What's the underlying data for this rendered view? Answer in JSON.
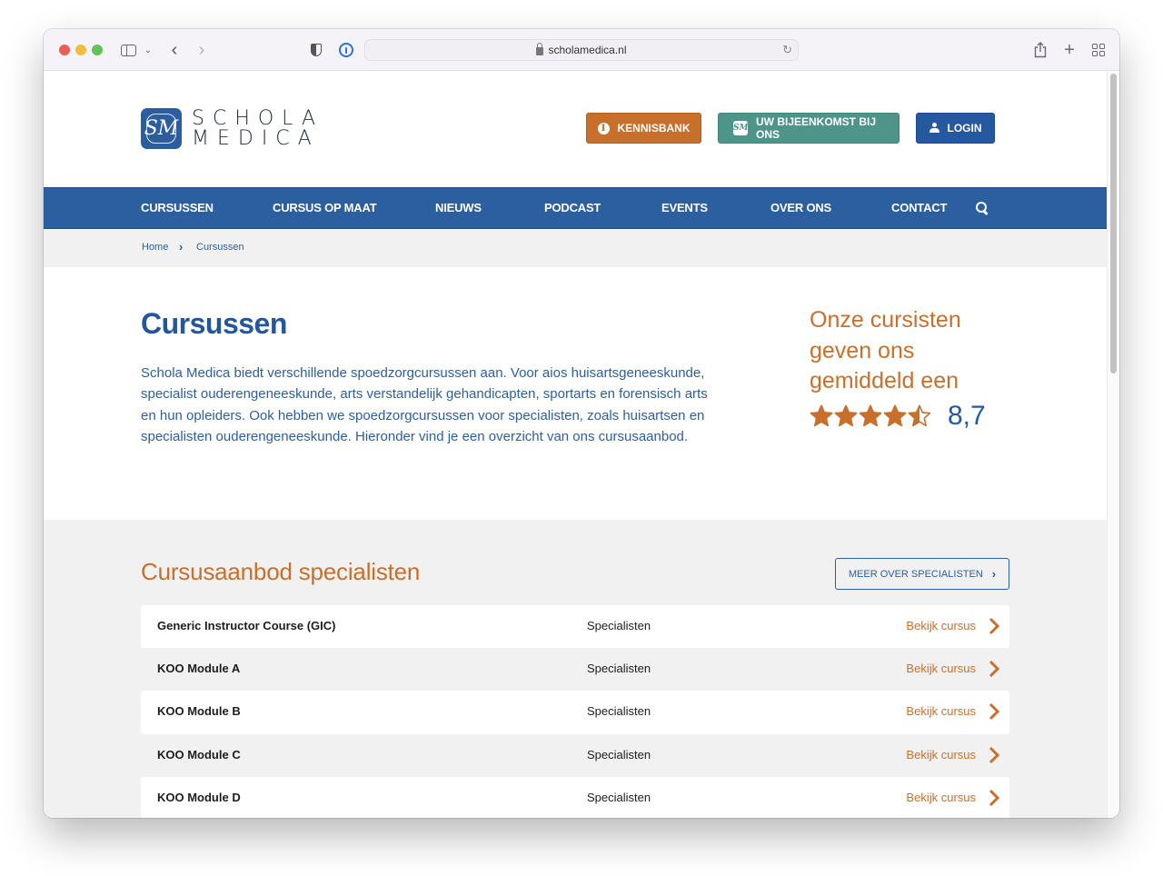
{
  "browser": {
    "url": "scholamedica.nl"
  },
  "header": {
    "logo_line1": "SCHOLA",
    "logo_line2": "MEDICA",
    "logo_mark": "SM",
    "buttons": {
      "kennisbank": "KENNISBANK",
      "bijeenkomst": "UW BIJEENKOMST BIJ ONS",
      "login": "LOGIN"
    },
    "colors": {
      "kennisbank": "#c8702b",
      "bijeenkomst": "#4f9489",
      "login": "#2658a0"
    }
  },
  "nav": {
    "items": [
      {
        "label": "CURSUSSEN"
      },
      {
        "label": "CURSUS OP MAAT"
      },
      {
        "label": "NIEUWS"
      },
      {
        "label": "PODCAST"
      },
      {
        "label": "EVENTS"
      },
      {
        "label": "OVER ONS"
      },
      {
        "label": "CONTACT"
      }
    ],
    "color": "#2c5fa0"
  },
  "breadcrumb": {
    "home": "Home",
    "separator": "›",
    "current": "Cursussen"
  },
  "intro": {
    "title": "Cursussen",
    "text": "Schola Medica biedt verschillende spoedzorgcursussen aan. Voor aios huisartsgeneeskunde, specialist ouderengeneeskunde, arts verstandelijk gehandicapten, sportarts en forensisch arts en hun opleiders. Ook hebben we spoedzorgcursussen voor specialisten, zoals huisartsen en specialisten ouderengeneeskunde. Hieronder vind je een overzicht van ons cursusaanbod."
  },
  "rating": {
    "text": "Onze cursisten geven ons gemiddeld een",
    "stars_filled": 4.5,
    "stars_total": 5,
    "value": "8,7",
    "star_color": "#c8702b"
  },
  "courses": {
    "title": "Cursusaanbod specialisten",
    "more_button": "MEER OVER SPECIALISTEN",
    "link_label": "Bekijk cursus",
    "rows": [
      {
        "name": "Generic Instructor Course (GIC)",
        "category": "Specialisten"
      },
      {
        "name": "KOO Module A",
        "category": "Specialisten"
      },
      {
        "name": "KOO Module B",
        "category": "Specialisten"
      },
      {
        "name": "KOO Module C",
        "category": "Specialisten"
      },
      {
        "name": "KOO Module D",
        "category": "Specialisten"
      }
    ]
  }
}
